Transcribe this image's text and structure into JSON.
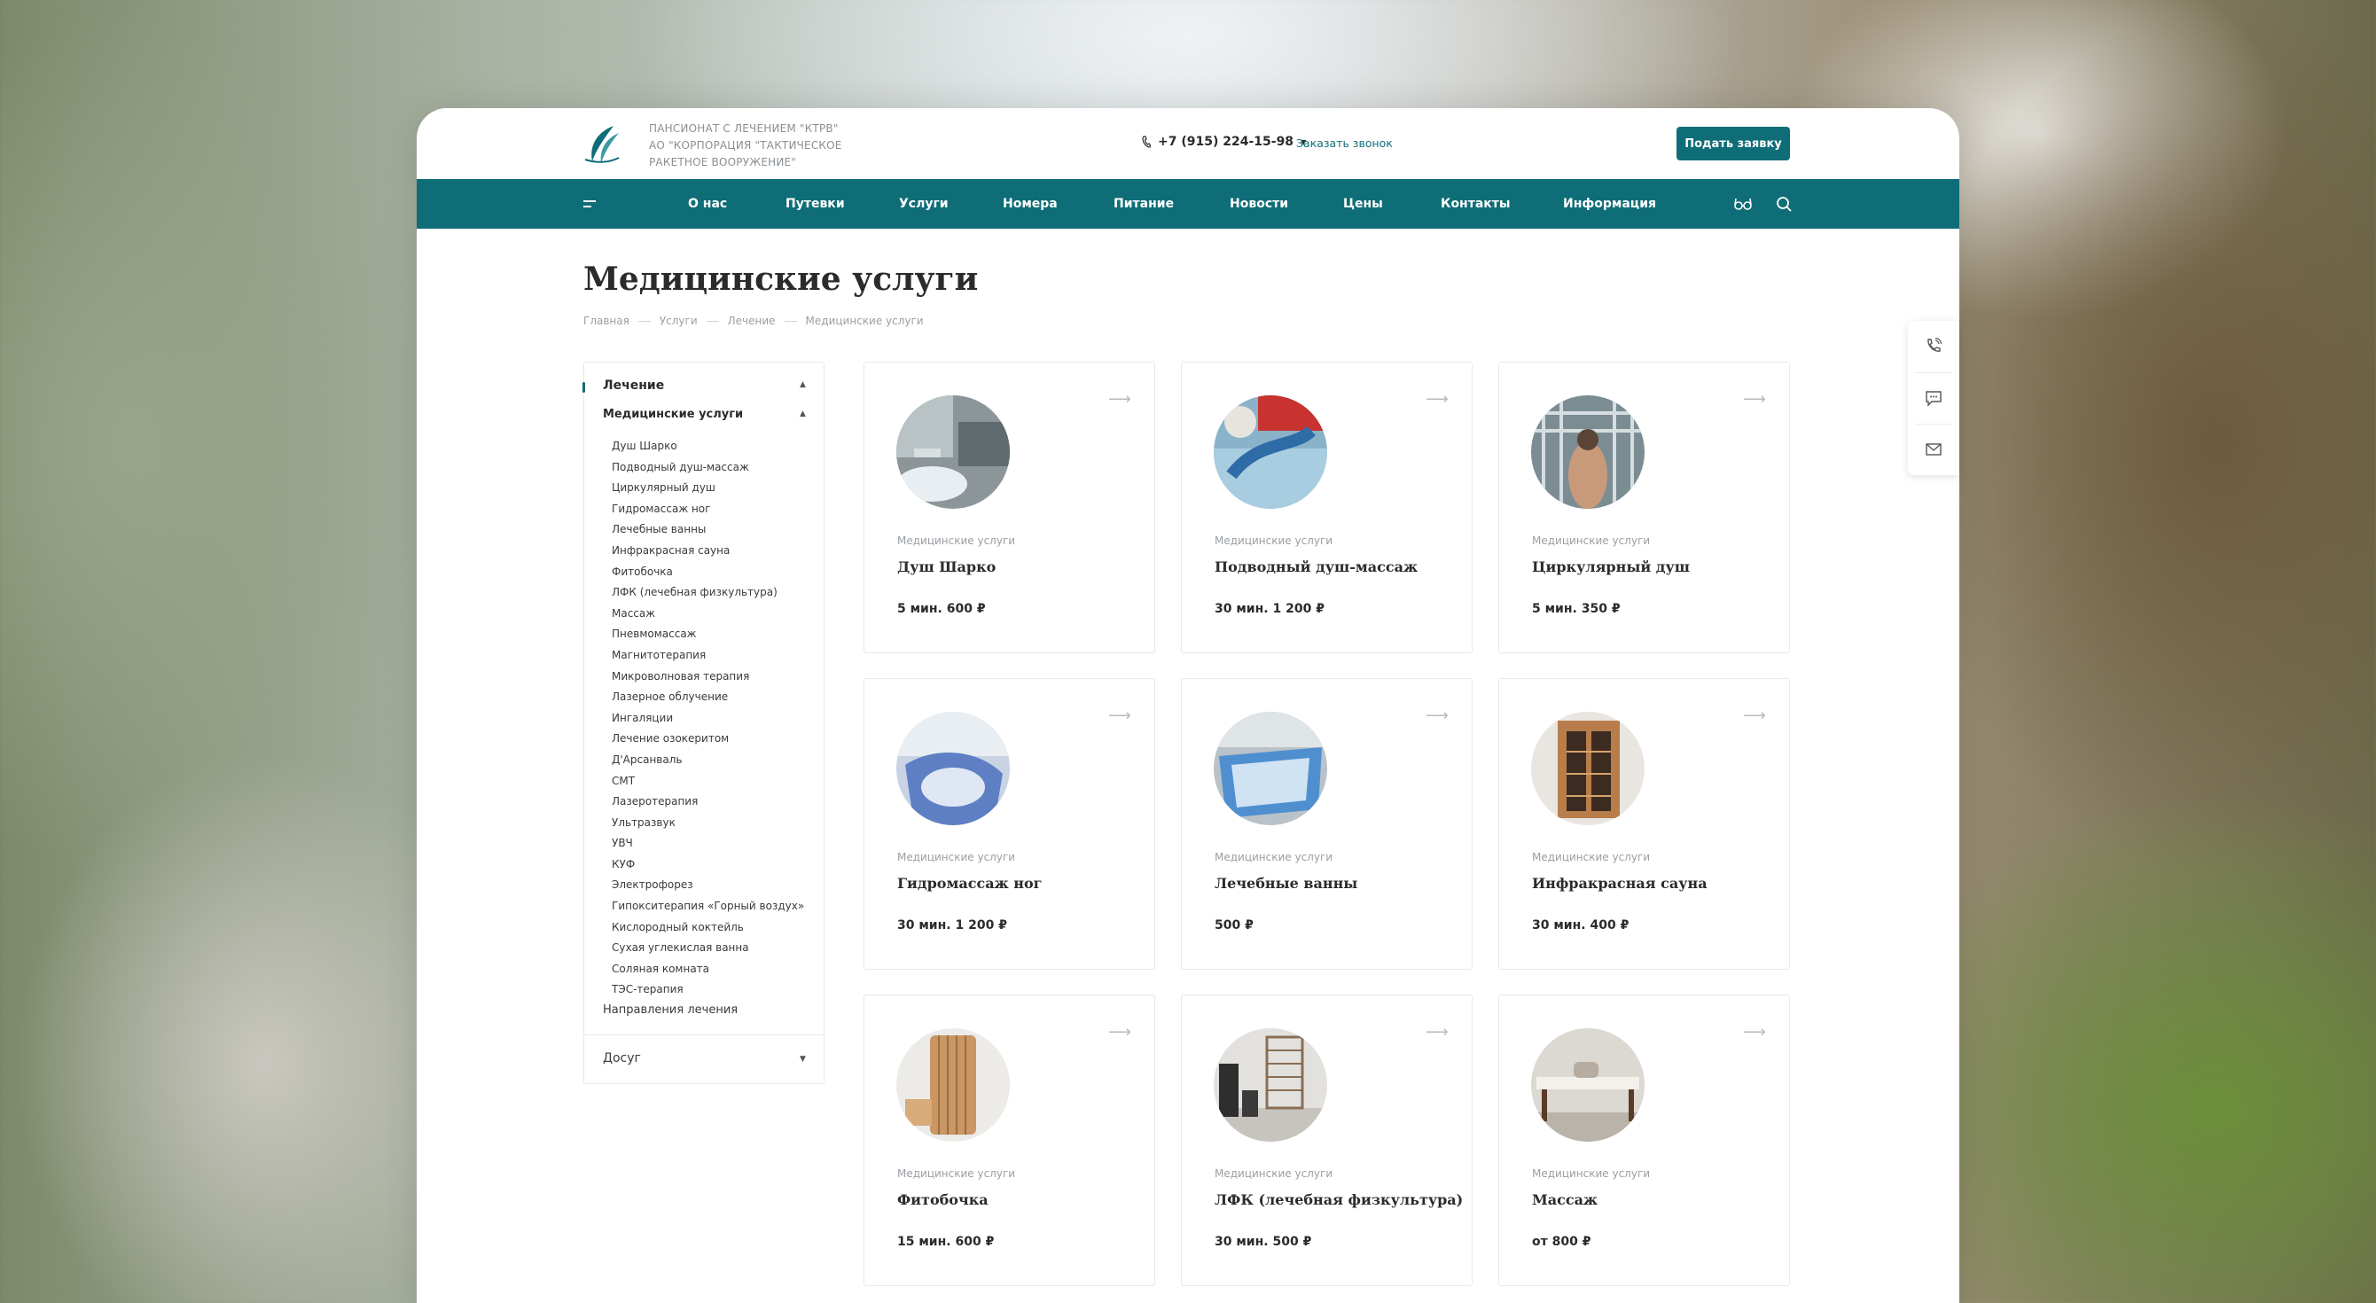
{
  "header": {
    "org_lines": [
      "ПАНСИОНАТ С ЛЕЧЕНИЕМ \"КТРВ\"",
      "АО \"КОРПОРАЦИЯ \"ТАКТИЧЕСКОЕ",
      "РАКЕТНОЕ ВООРУЖЕНИЕ\""
    ],
    "phone": "+7 (915) 224-15-98",
    "callback": "Заказать звонок",
    "apply_button": "Подать заявку"
  },
  "nav": {
    "items": [
      "О нас",
      "Путевки",
      "Услуги",
      "Номера",
      "Питание",
      "Новости",
      "Цены",
      "Контакты",
      "Информация"
    ],
    "icons": [
      "menu-icon",
      "glasses-icon",
      "search-icon"
    ]
  },
  "page": {
    "title": "Медицинские услуги",
    "breadcrumbs": [
      "Главная",
      "Услуги",
      "Лечение",
      "Медицинские услуги"
    ]
  },
  "sidebar": {
    "section": "Лечение",
    "subsection": "Медицинские услуги",
    "items": [
      "Душ Шарко",
      "Подводный душ-массаж",
      "Циркулярный душ",
      "Гидромассаж ног",
      "Лечебные ванны",
      "Инфракрасная сауна",
      "Фитобочка",
      "ЛФК (лечебная физкультура)",
      "Массаж",
      "Пневмомассаж",
      "Магнитотерапия",
      "Микроволновая терапия",
      "Лазерное облучение",
      "Ингаляции",
      "Лечение озокеритом",
      "Д'Арсанваль",
      "СМТ",
      "Лазеротерапия",
      "Ультразвук",
      "УВЧ",
      "КУФ",
      "Электрофорез",
      "Гипокситерапия «Горный воздух»",
      "Кислородный коктейль",
      "Сухая углекислая ванна",
      "Соляная комната",
      "ТЭС-терапия"
    ],
    "directions": "Направления лечения",
    "leisure": "Досуг"
  },
  "cards": [
    {
      "category": "Медицинские услуги",
      "name": "Душ Шарко",
      "price": "5 мин. 600 ₽"
    },
    {
      "category": "Медицинские услуги",
      "name": "Подводный душ-массаж",
      "price": "30 мин. 1 200 ₽"
    },
    {
      "category": "Медицинские услуги",
      "name": "Циркулярный душ",
      "price": "5 мин. 350 ₽"
    },
    {
      "category": "Медицинские услуги",
      "name": "Гидромассаж ног",
      "price": "30 мин. 1 200 ₽"
    },
    {
      "category": "Медицинские услуги",
      "name": "Лечебные ванны",
      "price": "500 ₽"
    },
    {
      "category": "Медицинские услуги",
      "name": "Инфракрасная сауна",
      "price": "30 мин. 400 ₽"
    },
    {
      "category": "Медицинские услуги",
      "name": "Фитобочка",
      "price": "15 мин. 600 ₽"
    },
    {
      "category": "Медицинские услуги",
      "name": "ЛФК (лечебная физкультура)",
      "price": "30 мин. 500 ₽"
    },
    {
      "category": "Медицинские услуги",
      "name": "Массаж",
      "price": "от 800 ₽"
    }
  ],
  "colors": {
    "accent": "#0f6d77"
  },
  "floating_icons": [
    "phone-call-icon",
    "chat-icon",
    "mail-icon"
  ]
}
